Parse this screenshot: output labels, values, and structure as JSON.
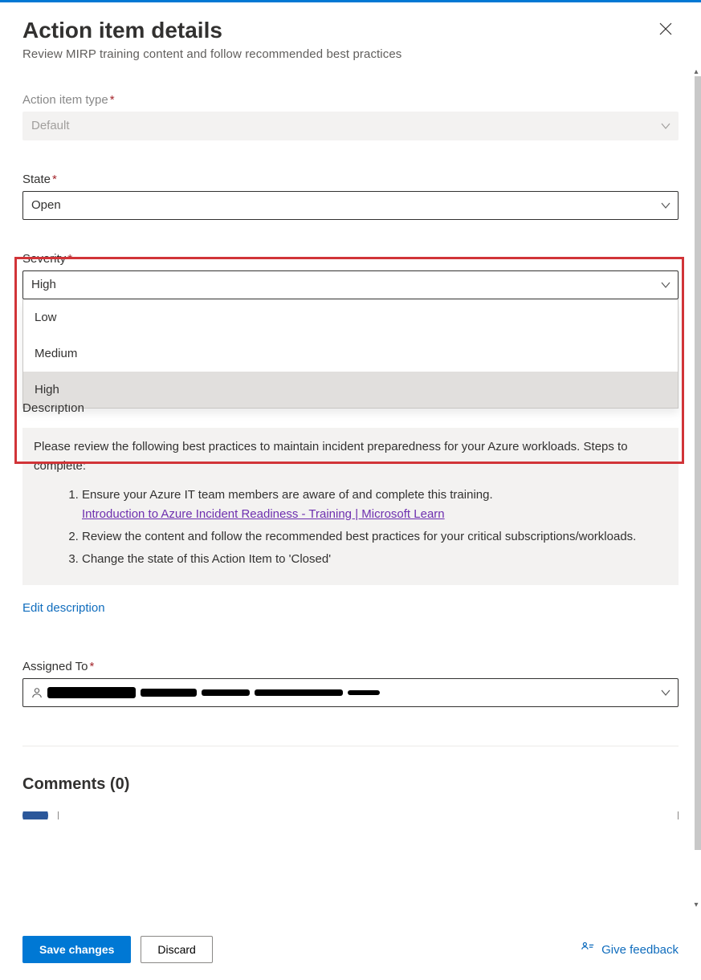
{
  "header": {
    "title": "Action item details",
    "subtitle": "Review MIRP training content and follow recommended best practices"
  },
  "fields": {
    "type": {
      "label": "Action item type",
      "value": "Default",
      "required": true,
      "readonly": true
    },
    "state": {
      "label": "State",
      "value": "Open",
      "required": true
    },
    "severity": {
      "label": "Severity",
      "value": "High",
      "required": true,
      "options": [
        "Low",
        "Medium",
        "High"
      ],
      "selected_option": "High"
    },
    "description": {
      "hidden_label": "Description",
      "intro": "Please review the following best practices to maintain incident preparedness for your Azure workloads. Steps to complete:",
      "steps": [
        "Ensure your Azure IT team members are aware of and complete this training.",
        "Review the content and follow the recommended best practices for your critical subscriptions/workloads.",
        "Change the state of this Action Item to 'Closed'"
      ],
      "link_text": "Introduction to Azure Incident Readiness - Training | Microsoft Learn",
      "edit_label": "Edit description"
    },
    "assigned_to": {
      "label": "Assigned To",
      "required": true,
      "value_redacted": true
    }
  },
  "comments": {
    "header_prefix": "Comments",
    "count": 0
  },
  "footer": {
    "save_label": "Save changes",
    "discard_label": "Discard",
    "feedback_label": "Give feedback"
  }
}
